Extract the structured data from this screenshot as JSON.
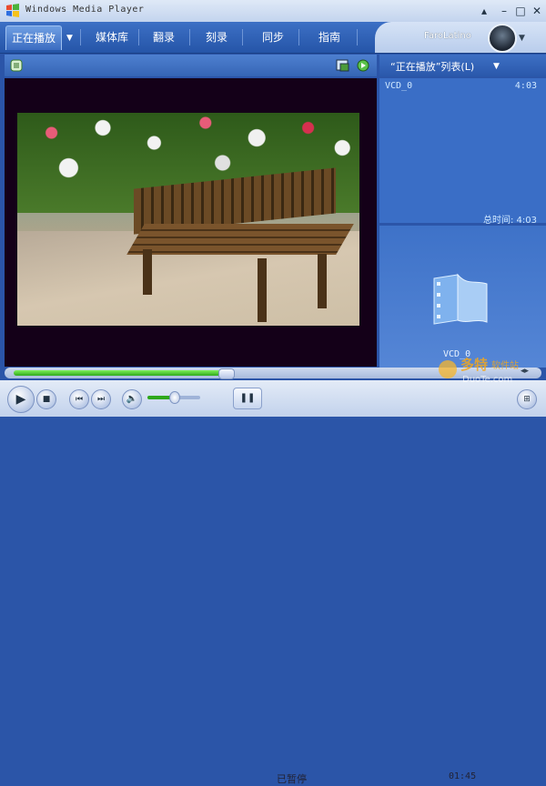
{
  "window": {
    "title": "Windows Media Player"
  },
  "nav": {
    "tabs": [
      {
        "label": "正在播放"
      },
      {
        "label": "媒体库"
      },
      {
        "label": "翻录"
      },
      {
        "label": "刻录"
      },
      {
        "label": "同步"
      },
      {
        "label": "指南"
      }
    ],
    "user_name": "FaroLatino"
  },
  "playlist": {
    "title": "“正在播放”列表(L)",
    "items": [
      {
        "name": "VCD_0",
        "duration": "4:03"
      }
    ],
    "total_label": "总时间: 4:03"
  },
  "art": {
    "caption": "VCD_0"
  },
  "controls": {
    "status": "已暂停",
    "time": "01:45"
  },
  "watermark": {
    "text": "多特软件站",
    "url": "DuoTe.com"
  },
  "colors": {
    "accent": "#2b55a8",
    "progress": "#2ea81b"
  }
}
